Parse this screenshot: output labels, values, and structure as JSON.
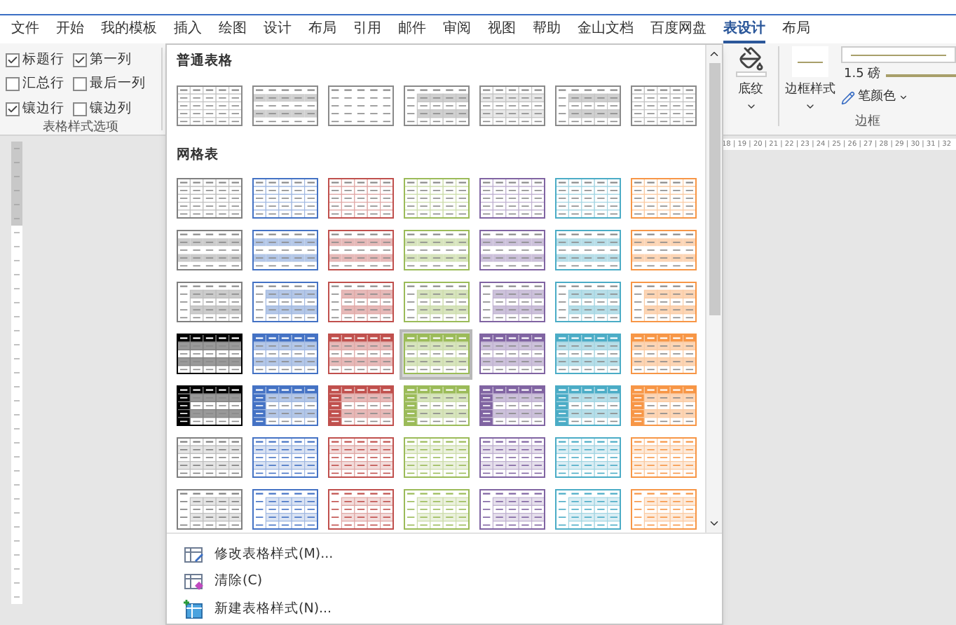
{
  "tabs": [
    {
      "label": "文件",
      "selected": false
    },
    {
      "label": "开始",
      "selected": false
    },
    {
      "label": "我的模板",
      "selected": false
    },
    {
      "label": "插入",
      "selected": false
    },
    {
      "label": "绘图",
      "selected": false
    },
    {
      "label": "设计",
      "selected": false
    },
    {
      "label": "布局",
      "selected": false
    },
    {
      "label": "引用",
      "selected": false
    },
    {
      "label": "邮件",
      "selected": false
    },
    {
      "label": "审阅",
      "selected": false
    },
    {
      "label": "视图",
      "selected": false
    },
    {
      "label": "帮助",
      "selected": false
    },
    {
      "label": "金山文档",
      "selected": false
    },
    {
      "label": "百度网盘",
      "selected": false
    },
    {
      "label": "表设计",
      "selected": true
    },
    {
      "label": "布局",
      "selected": false
    }
  ],
  "style_options": {
    "title": "表格样式选项",
    "options": [
      {
        "label": "标题行",
        "checked": true
      },
      {
        "label": "第一列",
        "checked": true
      },
      {
        "label": "汇总行",
        "checked": false
      },
      {
        "label": "最后一列",
        "checked": false
      },
      {
        "label": "镶边行",
        "checked": true
      },
      {
        "label": "镶边列",
        "checked": false
      }
    ]
  },
  "gallery": {
    "plain_title": "普通表格",
    "plain_styles": [
      {
        "kind": "grid",
        "selected": false
      },
      {
        "kind": "banded",
        "selected": false
      },
      {
        "kind": "lines",
        "selected": false
      },
      {
        "kind": "first-column",
        "selected": false
      },
      {
        "kind": "light",
        "selected": false
      },
      {
        "kind": "first-column",
        "selected": false
      },
      {
        "kind": "grid",
        "selected": false
      }
    ],
    "grid_title": "网格表",
    "grid_rows": [
      {
        "kind": "grid",
        "items": [
          {
            "color": "#7f7f7f",
            "selected": false
          },
          {
            "color": "#4472c4",
            "selected": false
          },
          {
            "color": "#c0504d",
            "selected": false
          },
          {
            "color": "#9bbb59",
            "selected": false
          },
          {
            "color": "#8064a2",
            "selected": false
          },
          {
            "color": "#4bacc6",
            "selected": false
          },
          {
            "color": "#f79646",
            "selected": false
          }
        ]
      },
      {
        "kind": "banded",
        "items": [
          {
            "color": "#7f7f7f",
            "selected": false
          },
          {
            "color": "#4472c4",
            "selected": false
          },
          {
            "color": "#c0504d",
            "selected": false
          },
          {
            "color": "#9bbb59",
            "selected": false
          },
          {
            "color": "#8064a2",
            "selected": false
          },
          {
            "color": "#4bacc6",
            "selected": false
          },
          {
            "color": "#f79646",
            "selected": false
          }
        ]
      },
      {
        "kind": "first-column",
        "items": [
          {
            "color": "#7f7f7f",
            "selected": false
          },
          {
            "color": "#4472c4",
            "selected": false
          },
          {
            "color": "#c0504d",
            "selected": false
          },
          {
            "color": "#9bbb59",
            "selected": false
          },
          {
            "color": "#8064a2",
            "selected": false
          },
          {
            "color": "#4bacc6",
            "selected": false
          },
          {
            "color": "#f79646",
            "selected": false
          }
        ]
      },
      {
        "kind": "header",
        "items": [
          {
            "color": "#000000",
            "selected": false
          },
          {
            "color": "#4472c4",
            "selected": false
          },
          {
            "color": "#c0504d",
            "selected": false
          },
          {
            "color": "#9bbb59",
            "selected": true
          },
          {
            "color": "#8064a2",
            "selected": false
          },
          {
            "color": "#4bacc6",
            "selected": false
          },
          {
            "color": "#f79646",
            "selected": false
          }
        ]
      },
      {
        "kind": "header-first",
        "items": [
          {
            "color": "#000000",
            "selected": false
          },
          {
            "color": "#4472c4",
            "selected": false
          },
          {
            "color": "#c0504d",
            "selected": false
          },
          {
            "color": "#9bbb59",
            "selected": false
          },
          {
            "color": "#8064a2",
            "selected": false
          },
          {
            "color": "#4bacc6",
            "selected": false
          },
          {
            "color": "#f79646",
            "selected": false
          }
        ]
      },
      {
        "kind": "light",
        "items": [
          {
            "color": "#7f7f7f",
            "selected": false
          },
          {
            "color": "#4472c4",
            "selected": false
          },
          {
            "color": "#c0504d",
            "selected": false
          },
          {
            "color": "#9bbb59",
            "selected": false
          },
          {
            "color": "#8064a2",
            "selected": false
          },
          {
            "color": "#4bacc6",
            "selected": false
          },
          {
            "color": "#f79646",
            "selected": false
          }
        ]
      },
      {
        "kind": "light-first",
        "items": [
          {
            "color": "#7f7f7f",
            "selected": false
          },
          {
            "color": "#4472c4",
            "selected": false
          },
          {
            "color": "#c0504d",
            "selected": false
          },
          {
            "color": "#9bbb59",
            "selected": false
          },
          {
            "color": "#8064a2",
            "selected": false
          },
          {
            "color": "#4bacc6",
            "selected": false
          },
          {
            "color": "#f79646",
            "selected": false
          }
        ]
      }
    ],
    "menu": [
      {
        "kind": "modify",
        "label": "修改表格样式(M)..."
      },
      {
        "kind": "clear",
        "label": "清除(C)"
      },
      {
        "kind": "new",
        "label": "新建表格样式(N)..."
      }
    ]
  },
  "shading": {
    "label": "底纹"
  },
  "borders": {
    "style_label": "边框样式",
    "weight": "1.5 磅",
    "pen_color": "笔颜色",
    "title": "边框"
  },
  "ruler": "18 | 19 | 20 | 21 | 22 | 23 | 24 | 25 | 26 | 27 | 28 | 29 | 30 | 31 | 32"
}
